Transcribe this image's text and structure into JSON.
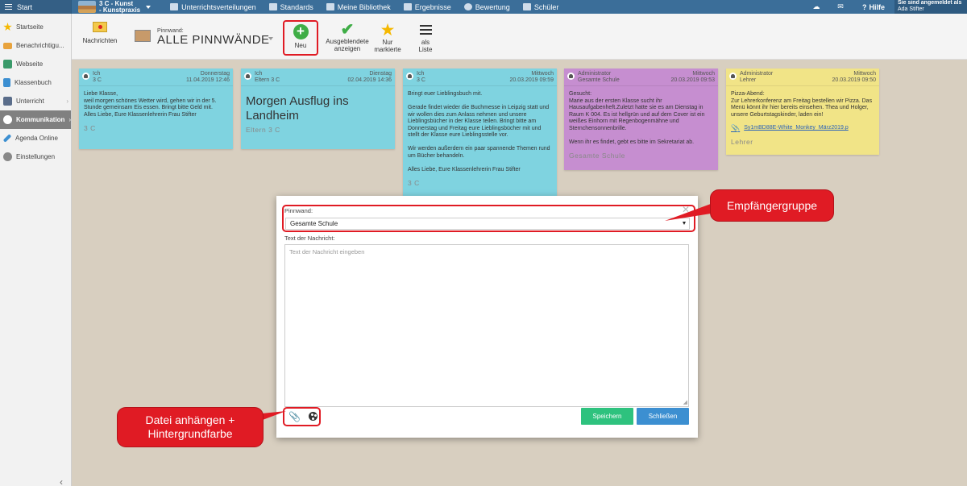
{
  "topbar": {
    "start": "Start",
    "class_line1": "3 C - Kunst",
    "class_line2": "- Kunstpraxis",
    "nav": [
      "Unterrichtsverteilungen",
      "Standards",
      "Meine Bibliothek",
      "Ergebnisse",
      "Bewertung",
      "Schüler"
    ],
    "help": "Hilfe",
    "user_line1": "Sie sind angemeldet als",
    "user_line2": "Ada Stifter"
  },
  "sidebar": {
    "items": [
      {
        "label": "Startseite",
        "icon": "star-icon",
        "color": "#f5b800"
      },
      {
        "label": "Benachrichtigu...",
        "icon": "mail-icon",
        "color": "#e8a33d"
      },
      {
        "label": "Webseite",
        "icon": "home-icon",
        "color": "#3a9a6a"
      },
      {
        "label": "Klassenbuch",
        "icon": "book-icon",
        "color": "#3c8fd1"
      },
      {
        "label": "Unterricht",
        "icon": "board-icon",
        "color": "#5a6d8a"
      },
      {
        "label": "Kommunikation",
        "icon": "chat-icon",
        "color": "#666666"
      },
      {
        "label": "Agenda Online",
        "icon": "pen-icon",
        "color": "#3c8fd1"
      },
      {
        "label": "Einstellungen",
        "icon": "gear-icon",
        "color": "#888888"
      }
    ]
  },
  "toolbar": {
    "messages": "Nachrichten",
    "pinboard_label": "Pinnwand:",
    "pinboard_title": "ALLE PINNWÄNDE",
    "new": "Neu",
    "hidden_1": "Ausgeblendete",
    "hidden_2": "anzeigen",
    "marked_1": "Nur",
    "marked_2": "markierte",
    "list_1": "als",
    "list_2": "Liste"
  },
  "cards": [
    {
      "who1": "Ich",
      "who2": "3 C",
      "day": "Donnerstag",
      "date": "11.04.2019 12:46",
      "text": "Liebe Klasse,\nweil morgen schönes Wetter wird, gehen wir in der 5. Stunde gemeinsam Eis essen. Bringt bitte Geld mit.\nAlles Liebe, Eure Klassenlehrerin Frau Stifter",
      "footer": "3 C"
    },
    {
      "who1": "Ich",
      "who2": "Eltern 3 C",
      "day": "Dienstag",
      "date": "02.04.2019 14:36",
      "text": "Morgen Ausflug ins Landheim",
      "footer": "Eltern 3 C"
    },
    {
      "who1": "Ich",
      "who2": "3 C",
      "day": "Mittwoch",
      "date": "20.03.2019 09:59",
      "text": "Bringt euer Lieblingsbuch mit.\n\nGerade findet wieder die Buchmesse in Leipzig statt und wir wollen dies zum Anlass nehmen und unsere Lieblingsbücher in der Klasse teilen. Bringt bitte am Donnerstag und Freitag eure Lieblingsbücher mit und stellt der Klasse eure Lieblingsstelle vor.\n\nWir werden außerdem ein paar spannende Themen rund um Bücher behandeln.\n\nAlles Liebe, Eure Klassenlehrerin Frau Stifter",
      "footer": "3 C"
    },
    {
      "who1": "Administrator",
      "who2": "Gesamte Schule",
      "day": "Mittwoch",
      "date": "20.03.2019 09:53",
      "text": "Gesucht:\nMarie aus der ersten Klasse sucht ihr Hausaufgabenheft.Zuletzt hatte sie es am Dienstag in Raum K 004. Es ist hellgrün und auf dem Cover ist ein weißes Einhorn mit Regenbogenmähne und Sternchensonnenbrille.\n\nWenn ihr es findet, gebt es bitte im Sekretariat ab.",
      "footer": "Gesamte Schule"
    },
    {
      "who1": "Administrator",
      "who2": "Lehrer",
      "day": "Mittwoch",
      "date": "20.03.2019 09:50",
      "text": "Pizza-Abend:\nZur Lehrerkonferenz am Freitag bestellen wir Pizza. Das Menü könnt ihr hier bereits einsehen. Thea und Holger, unsere Geburtstagskinder, laden ein!",
      "attachment": "Sy1mBD88E-White_Monkey_März2019.p",
      "footer": "Lehrer"
    }
  ],
  "modal": {
    "pin_label": "Pinnwand:",
    "pin_value": "Gesamte Schule",
    "text_label": "Text der Nachricht:",
    "text_placeholder": "Text der Nachricht eingeben",
    "save": "Speichern",
    "close": "Schließen"
  },
  "callouts": {
    "recipients": "Empfängergruppe",
    "attach_1": "Datei anhängen +",
    "attach_2": "Hintergrundfarbe"
  },
  "colors": {
    "topbar": "#3b6e99",
    "card_cyan": "#7fd3e0",
    "card_purple": "#c68ed0",
    "card_yellow": "#f1e487",
    "save": "#2ec27e",
    "close": "#3c8fd1",
    "highlight": "#e01b24"
  }
}
